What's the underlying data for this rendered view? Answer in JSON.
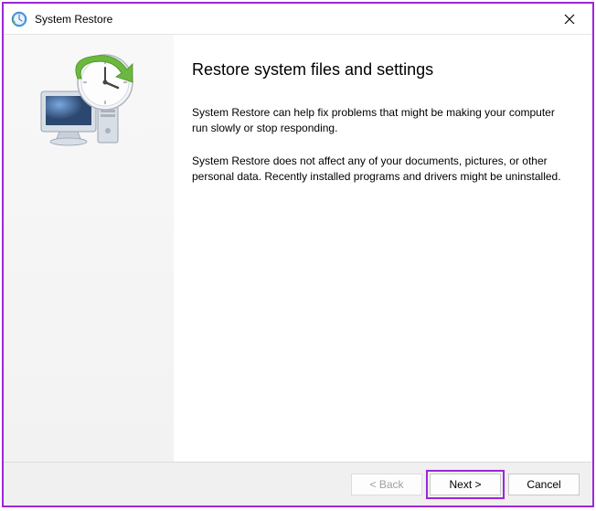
{
  "titlebar": {
    "title": "System Restore"
  },
  "main": {
    "heading": "Restore system files and settings",
    "paragraph1": "System Restore can help fix problems that might be making your computer run slowly or stop responding.",
    "paragraph2": "System Restore does not affect any of your documents, pictures, or other personal data. Recently installed programs and drivers might be uninstalled."
  },
  "footer": {
    "back_label": "< Back",
    "next_label": "Next >",
    "cancel_label": "Cancel"
  }
}
